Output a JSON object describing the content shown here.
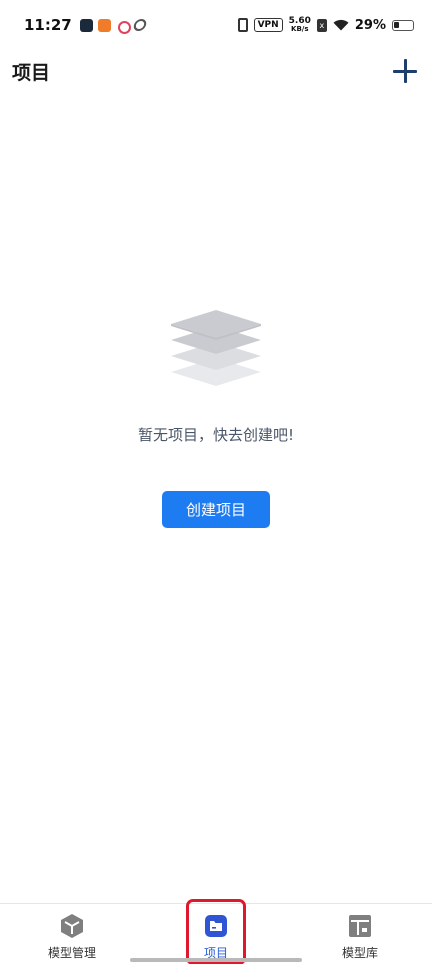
{
  "status_bar": {
    "time": "11:27",
    "vpn": "VPN",
    "net_speed_value": "5.60",
    "net_speed_unit": "KB/s",
    "sim_label": "x",
    "battery": "29%"
  },
  "app_bar": {
    "title": "项目",
    "add_icon": "plus-icon"
  },
  "empty_state": {
    "icon": "layers-icon",
    "message": "暂无项目，快去创建吧!",
    "create_button_label": "创建项目"
  },
  "bottom_nav": {
    "items": [
      {
        "label": "模型管理",
        "icon": "cube-icon",
        "active": false
      },
      {
        "label": "项目",
        "icon": "folder-icon",
        "active": true
      },
      {
        "label": "模型库",
        "icon": "library-icon",
        "active": false
      }
    ]
  },
  "colors": {
    "accent": "#1e7cf2",
    "active_nav": "#2a5dd8",
    "highlight": "#e0182d"
  }
}
